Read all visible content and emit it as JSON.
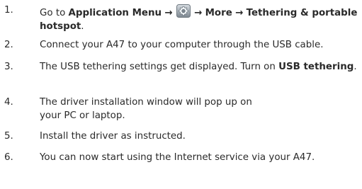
{
  "steps": [
    {
      "number": "1.",
      "lead": "Go to ",
      "menu": "Application Menu",
      "arrow1": "→",
      "icon": "settings-gear-icon",
      "arrow2": "→",
      "more": "More",
      "arrow3": "→",
      "target": "Tethering & portable hotspot",
      "end": "."
    },
    {
      "number": "2.",
      "text": "Connect your A47 to your computer through the USB cable."
    },
    {
      "number": "3.",
      "lead": "The USB tethering settings get displayed. Turn on ",
      "bold": "USB tethering",
      "end": "."
    },
    {
      "number": "4.",
      "text": "The driver installation window will pop up on your PC or laptop."
    },
    {
      "number": "5.",
      "text": "Install the driver as instructed."
    },
    {
      "number": "6.",
      "text": "You can now start using the Internet service via your A47."
    }
  ]
}
